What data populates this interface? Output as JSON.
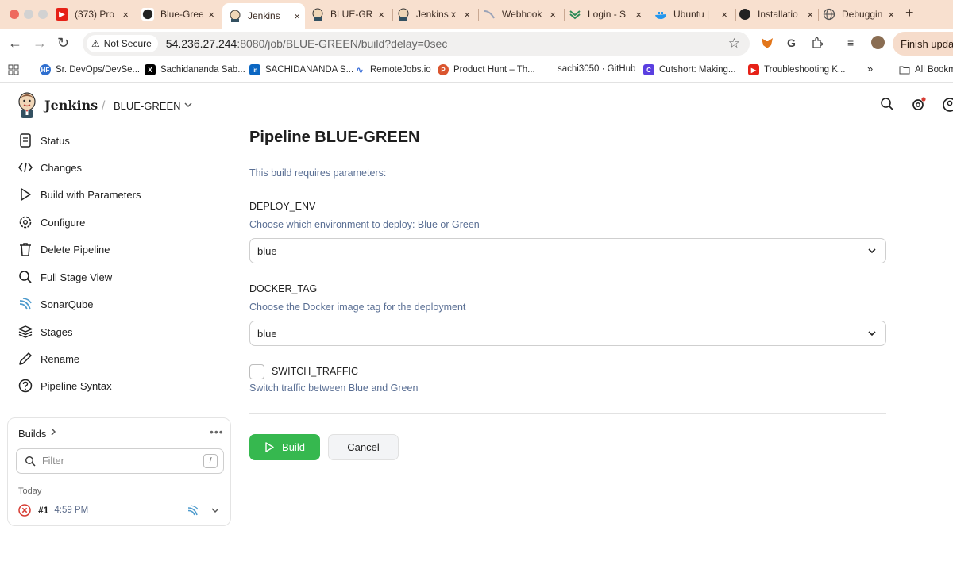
{
  "browser": {
    "tabs": [
      {
        "label": "(373) Pro",
        "icon": "youtube-icon",
        "active": false
      },
      {
        "label": "Blue-Gree",
        "icon": "github-icon",
        "active": false
      },
      {
        "label": "Jenkins",
        "icon": "jenkins-icon",
        "active": true
      },
      {
        "label": "BLUE-GR",
        "icon": "jenkins-icon",
        "active": false
      },
      {
        "label": "Jenkins x",
        "icon": "jenkins-icon",
        "active": false
      },
      {
        "label": "Webhook",
        "icon": "webhook-icon",
        "active": false
      },
      {
        "label": "Login - S",
        "icon": "login-icon",
        "active": false
      },
      {
        "label": "Ubuntu |",
        "icon": "docker-icon",
        "active": false
      },
      {
        "label": "Installatio",
        "icon": "github-icon",
        "active": false
      },
      {
        "label": "Debuggin",
        "icon": "globe-icon",
        "active": false
      }
    ],
    "close_glyph": "×",
    "new_tab_glyph": "+",
    "security_label": "Not Secure",
    "url_host": "54.236.27.244",
    "url_path": ":8080/job/BLUE-GREEN/build?delay=0sec",
    "finish_update_label": "Finish update",
    "bookmarks": [
      {
        "label": "Sr. DevOps/DevSe...",
        "icon": "hf-icon"
      },
      {
        "label": "Sachidananda Sab...",
        "icon": "x-icon"
      },
      {
        "label": "SACHIDANANDA S...",
        "icon": "linkedin-icon"
      },
      {
        "label": "RemoteJobs.io",
        "icon": "remotejobs-icon"
      },
      {
        "label": "Product Hunt – Th...",
        "icon": "producthunt-icon"
      },
      {
        "label": "sachi3050 · GitHub",
        "icon": "github-icon"
      },
      {
        "label": "Cutshort: Making...",
        "icon": "cutshort-icon"
      },
      {
        "label": "Troubleshooting K...",
        "icon": "youtube-icon"
      }
    ],
    "bookmarks_overflow": "»",
    "all_bookmarks_label": "All Bookmarks"
  },
  "jenkins": {
    "brand": "Jenkins",
    "breadcrumb_sep": "/",
    "job_name": "BLUE-GREEN",
    "sidebar": [
      {
        "label": "Status",
        "icon": "status-icon"
      },
      {
        "label": "Changes",
        "icon": "code-icon"
      },
      {
        "label": "Build with Parameters",
        "icon": "play-icon"
      },
      {
        "label": "Configure",
        "icon": "gear-icon"
      },
      {
        "label": "Delete Pipeline",
        "icon": "trash-icon"
      },
      {
        "label": "Full Stage View",
        "icon": "search-icon"
      },
      {
        "label": "SonarQube",
        "icon": "sonarqube-icon"
      },
      {
        "label": "Stages",
        "icon": "stages-icon"
      },
      {
        "label": "Rename",
        "icon": "pencil-icon"
      },
      {
        "label": "Pipeline Syntax",
        "icon": "help-icon"
      }
    ],
    "builds": {
      "title": "Builds",
      "filter_placeholder": "Filter",
      "filter_shortcut": "/",
      "group_label": "Today",
      "items": [
        {
          "number": "#1",
          "time": "4:59 PM",
          "status": "failed"
        }
      ]
    },
    "page": {
      "title": "Pipeline BLUE-GREEN",
      "requires_params": "This build requires parameters:",
      "params": {
        "deploy_env": {
          "name": "DEPLOY_ENV",
          "description": "Choose which environment to deploy: Blue or Green",
          "value": "blue"
        },
        "docker_tag": {
          "name": "DOCKER_TAG",
          "description": "Choose the Docker image tag for the deployment",
          "value": "blue"
        },
        "switch_traffic": {
          "name": "SWITCH_TRAFFIC",
          "description": "Switch traffic between Blue and Green",
          "checked": false
        }
      },
      "build_button": "Build",
      "cancel_button": "Cancel"
    }
  },
  "colors": {
    "tabstrip": "#f8e0cf",
    "build_green": "#36b84f",
    "link_blue": "#5a6f94",
    "failed_red": "#d63b32"
  }
}
